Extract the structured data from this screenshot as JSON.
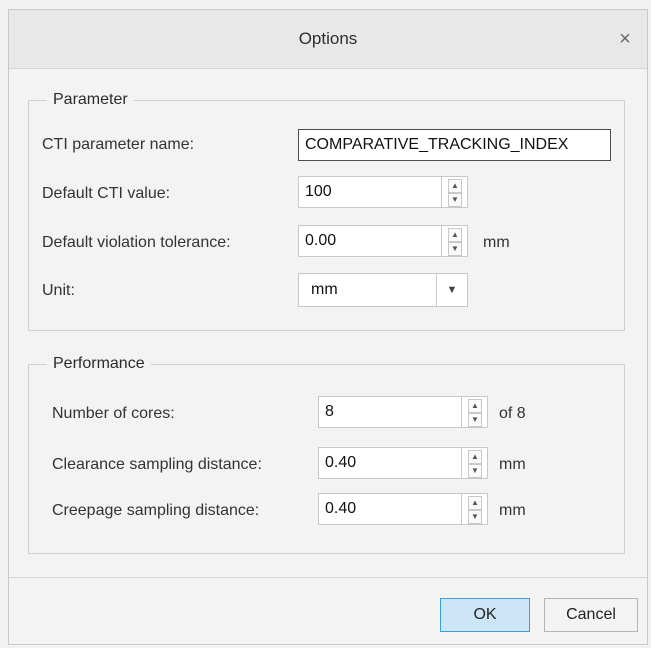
{
  "dialog": {
    "title": "Options",
    "close_glyph": "×",
    "close_icon": "close-icon"
  },
  "parameter": {
    "legend": "Parameter",
    "cti_name_label": "CTI parameter name:",
    "cti_name_value": "COMPARATIVE_TRACKING_INDEX",
    "default_cti_label": "Default CTI value:",
    "default_cti_value": "100",
    "violation_label": "Default violation tolerance:",
    "violation_value": "0.00",
    "violation_unit": "mm",
    "unit_label": "Unit:",
    "unit_value": "mm"
  },
  "performance": {
    "legend": "Performance",
    "cores_label": "Number of cores:",
    "cores_value": "8",
    "cores_suffix": "of 8",
    "clearance_label": "Clearance sampling distance:",
    "clearance_value": "0.40",
    "clearance_unit": "mm",
    "creepage_label": "Creepage sampling distance:",
    "creepage_value": "0.40",
    "creepage_unit": "mm"
  },
  "spinner": {
    "up_glyph": "▲",
    "down_glyph": "▼"
  },
  "dropdown": {
    "arrow_glyph": "▼"
  },
  "footer": {
    "ok_label": "OK",
    "cancel_label": "Cancel"
  },
  "colors": {
    "ok_fill": "#cde6f7",
    "ok_border": "#3c9de0"
  }
}
